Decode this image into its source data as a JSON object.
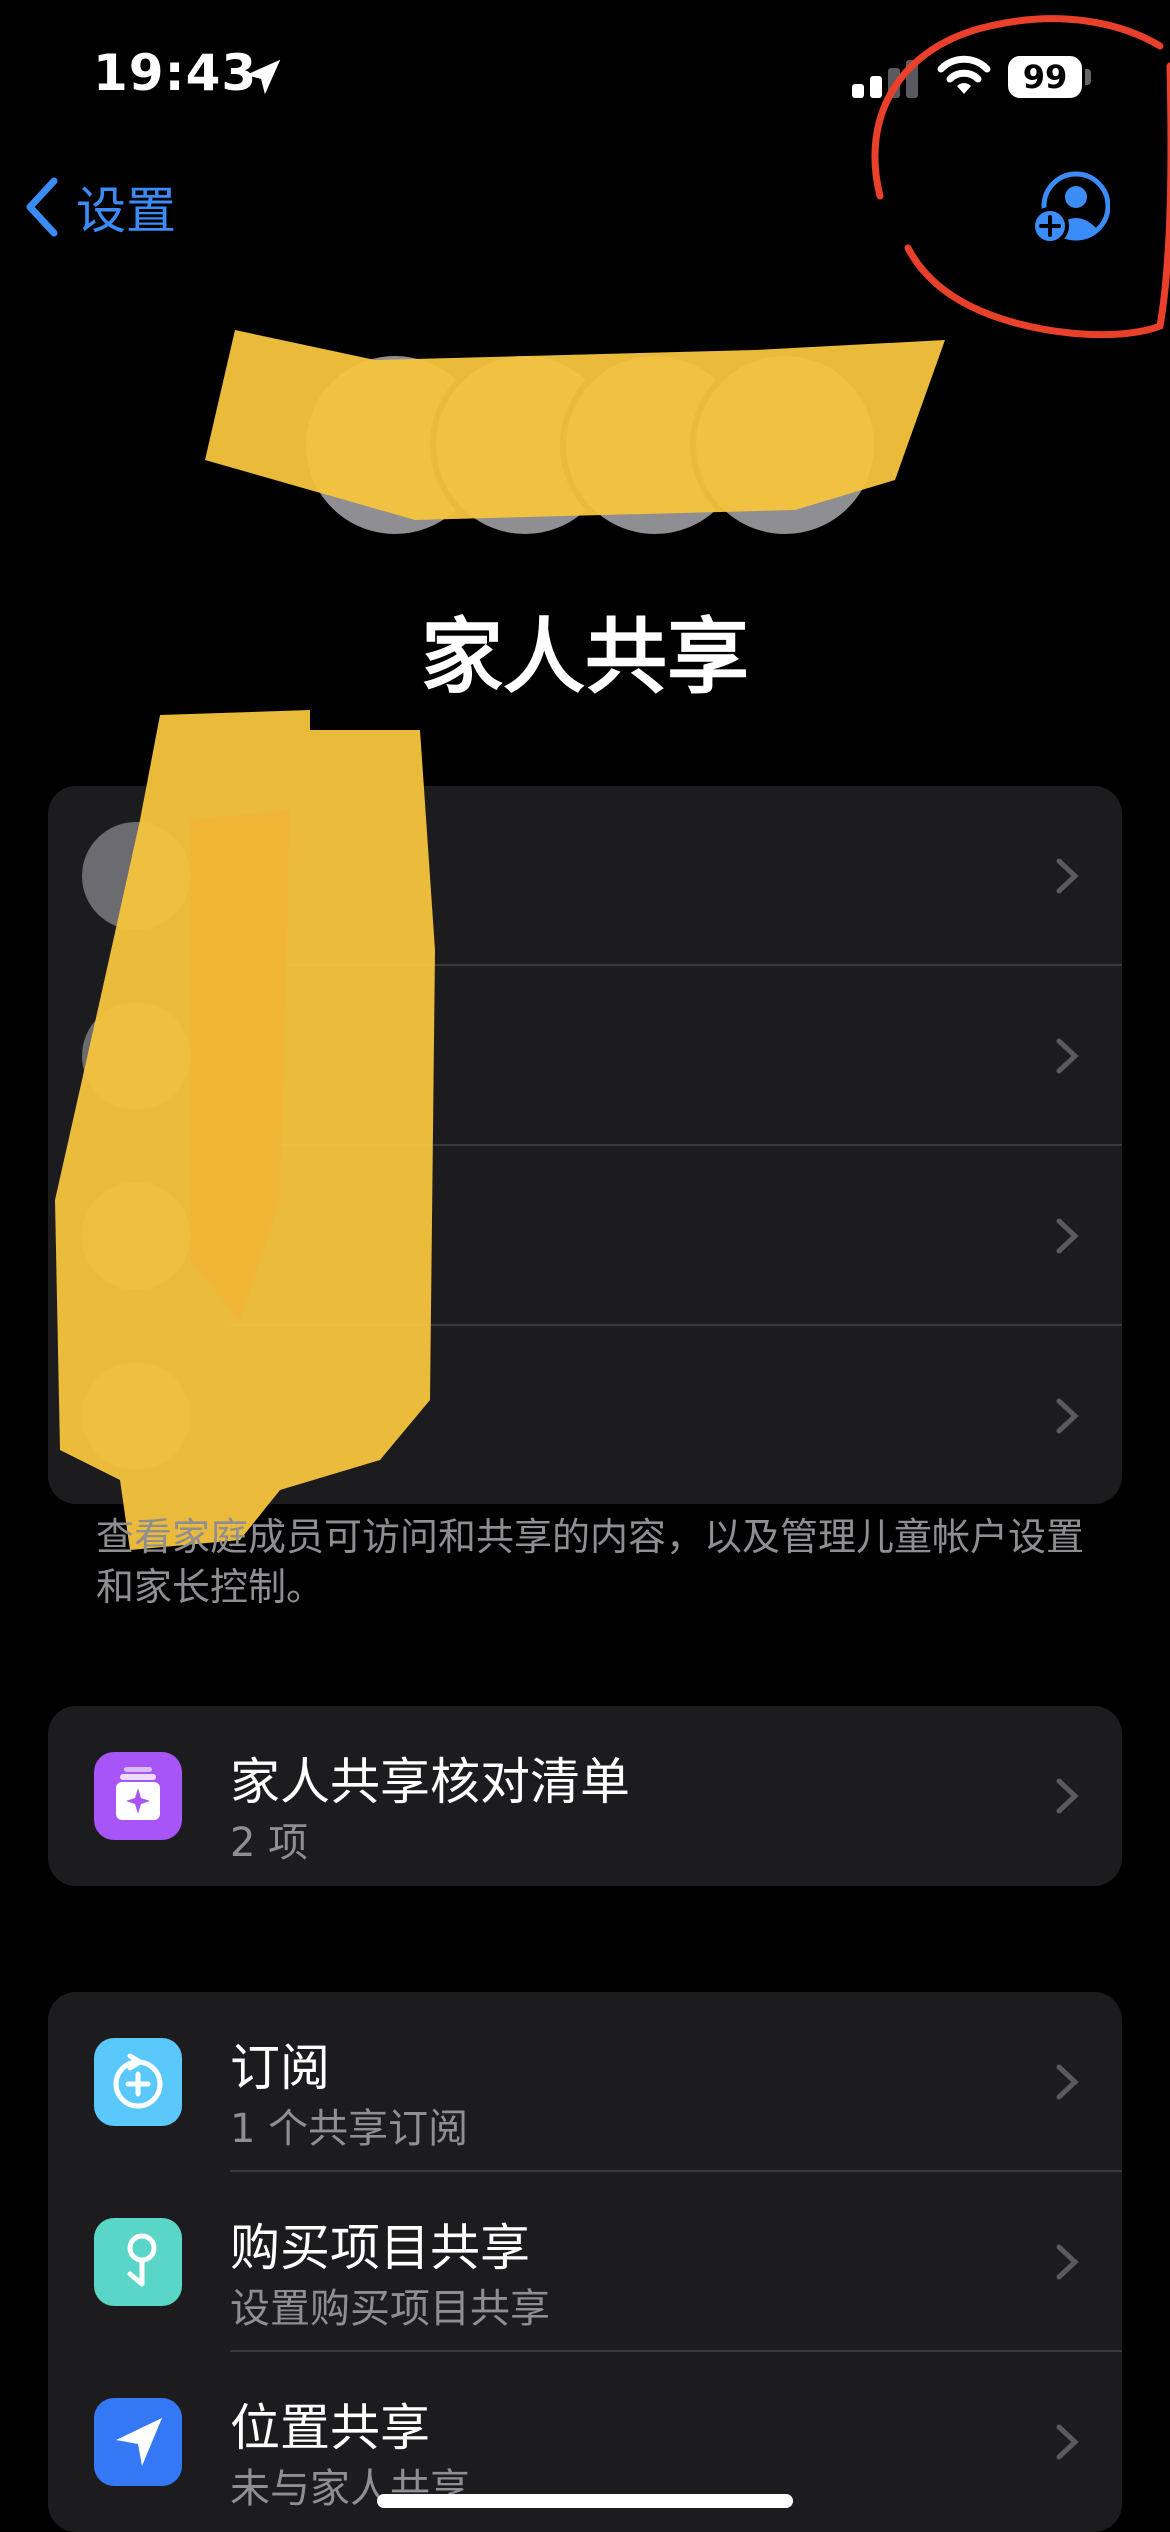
{
  "status_bar": {
    "time": "19:43",
    "battery_level": "99"
  },
  "nav": {
    "back_label": "设置"
  },
  "page_title": "家人共享",
  "members_note": "查看家庭成员可访问和共享的内容，以及管理儿童帐户设置和家长控制。",
  "checklist": {
    "title": "家人共享核对清单",
    "subtitle": "2 项"
  },
  "features": [
    {
      "title": "订阅",
      "subtitle": "1 个共享订阅",
      "icon": "subscriptions-icon",
      "color": "#5ac8fa"
    },
    {
      "title": "购买项目共享",
      "subtitle": "设置购买项目共享",
      "icon": "purchase-sharing-icon",
      "color": "#5ad6c8"
    },
    {
      "title": "位置共享",
      "subtitle": "未与家人共享",
      "icon": "location-sharing-icon",
      "color": "#3478f6"
    }
  ],
  "colors": {
    "accent": "#3b8cf7",
    "checklist_icon": "#a855f7",
    "annotation_red": "#e8402a",
    "redaction_yellow": "#f7c43d"
  }
}
